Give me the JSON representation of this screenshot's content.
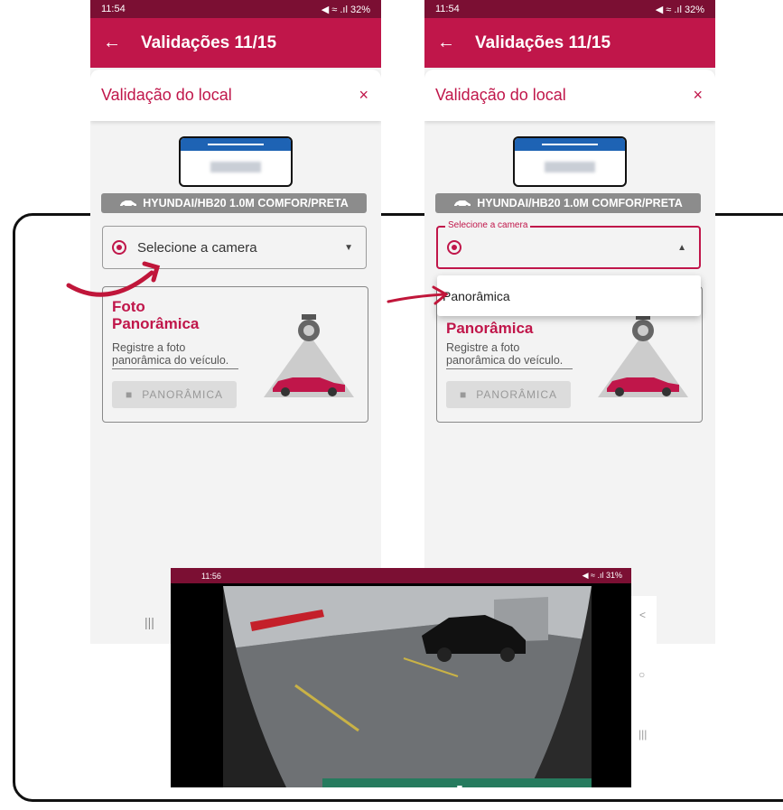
{
  "frames": [
    {
      "status": {
        "time": "11:54",
        "right": "◀ ≈ .ıl 32%"
      },
      "appbar": {
        "title": "Validações 11/15"
      },
      "sheet": {
        "title": "Validação do local",
        "close": "×"
      },
      "vehicle": "HYUNDAI/HB20 1.0M COMFOR/PRETA",
      "select": {
        "placeholder": "Selecione a camera",
        "state": "closed"
      },
      "card": {
        "title": "Foto Panorâmica",
        "desc": "Registre a foto panorâmica do veículo.",
        "button": "PANORÂMICA"
      },
      "nav": "|||"
    },
    {
      "status": {
        "time": "11:54",
        "right": "◀ ≈ .ıl 32%"
      },
      "appbar": {
        "title": "Validações 11/15"
      },
      "sheet": {
        "title": "Validação do local",
        "close": "×"
      },
      "vehicle": "HYUNDAI/HB20 1.0M COMFOR/PRETA",
      "select": {
        "label": "Selecione a camera",
        "state": "open"
      },
      "dropdown_option": "Panorâmica",
      "card": {
        "title": "Panorâmica",
        "desc": "Registre a foto panorâmica do veículo.",
        "button": "PANORÂMICA"
      }
    }
  ],
  "landscape": {
    "status": {
      "time": "11:56",
      "right": "◀ ≈ .ıl 31%"
    },
    "sysnav": [
      "<",
      "○",
      "|||"
    ]
  },
  "colors": {
    "primary": "#c0164a",
    "statusbar": "#7b0f33",
    "shoot_button": "#267b5e"
  }
}
